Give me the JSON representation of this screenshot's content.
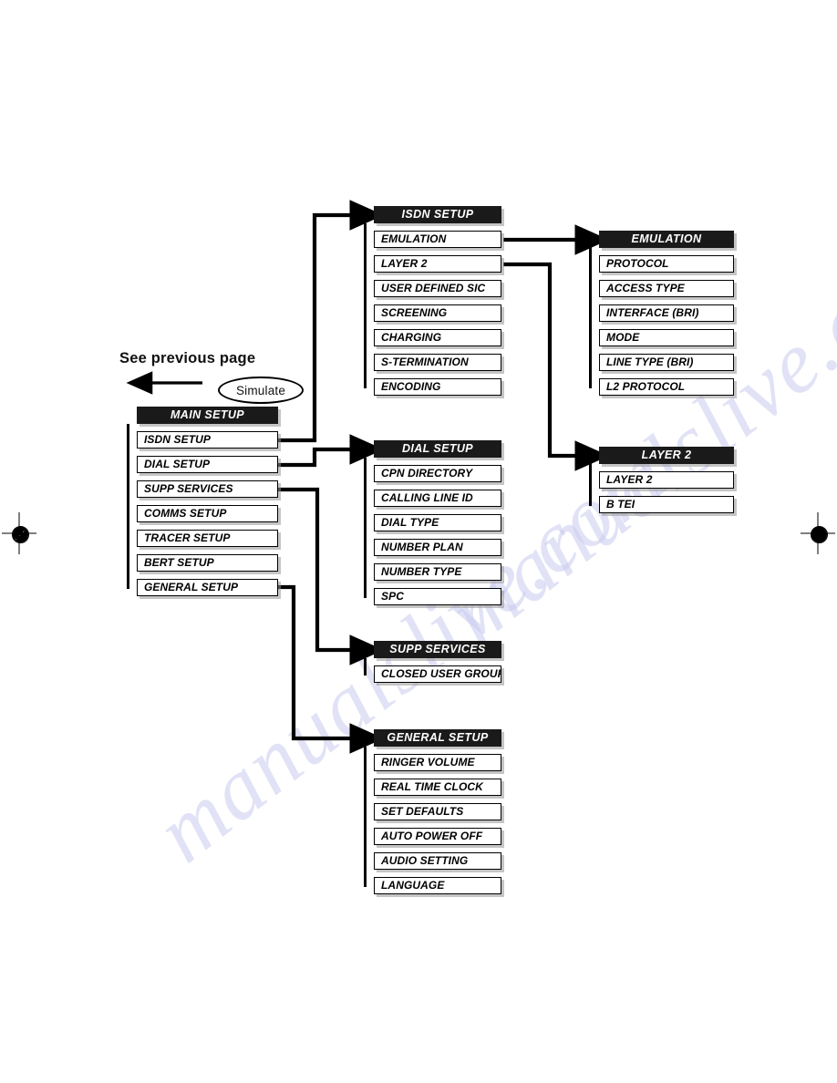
{
  "page": {
    "annotations": {
      "see_previous_page": "See previous page",
      "simulate": "Simulate"
    },
    "watermark": "manualslive.com",
    "colors": {
      "header_fill": "#1a1a1a",
      "header_text": "#ffffff",
      "item_fill": "#ffffff",
      "item_border": "#000000",
      "connector": "#000000",
      "shadow": "#969696",
      "watermark": "#c9ccef"
    }
  },
  "groups": {
    "main_setup": {
      "title": "MAIN SETUP",
      "items": [
        {
          "label": "ISDN SETUP"
        },
        {
          "label": "DIAL  SETUP"
        },
        {
          "label": "SUPP SERVICES"
        },
        {
          "label": "COMMS  SETUP"
        },
        {
          "label": "TRACER SETUP"
        },
        {
          "label": "BERT SETUP"
        },
        {
          "label": "GENERAL  SETUP"
        }
      ]
    },
    "isdn_setup": {
      "title": "ISDN SETUP",
      "items": [
        {
          "label": "EMULATION"
        },
        {
          "label": "LAYER 2"
        },
        {
          "label": "USER DEFINED SIC"
        },
        {
          "label": "SCREENING"
        },
        {
          "label": "CHARGING"
        },
        {
          "label": "S-TERMINATION"
        },
        {
          "label": "ENCODING"
        }
      ]
    },
    "emulation": {
      "title": "EMULATION",
      "items": [
        {
          "label": "PROTOCOL"
        },
        {
          "label": "ACCESS TYPE"
        },
        {
          "label": "INTERFACE (BRI)"
        },
        {
          "label": "MODE"
        },
        {
          "label": "LINE TYPE (BRI)"
        },
        {
          "label": "L2 PROTOCOL"
        }
      ]
    },
    "dial_setup": {
      "title": "DIAL SETUP",
      "items": [
        {
          "label": "CPN DIRECTORY"
        },
        {
          "label": "CALLING LINE ID"
        },
        {
          "label": "DIAL TYPE"
        },
        {
          "label": "NUMBER PLAN"
        },
        {
          "label": "NUMBER TYPE"
        },
        {
          "label": "SPC"
        }
      ]
    },
    "layer2": {
      "title": "LAYER 2",
      "items": [
        {
          "label": "LAYER 2"
        },
        {
          "label": "B TEI"
        }
      ]
    },
    "supp_services": {
      "title": "SUPP SERVICES",
      "items": [
        {
          "label": "CLOSED USER GROUP"
        }
      ]
    },
    "general_setup": {
      "title": "GENERAL SETUP",
      "items": [
        {
          "label": "RINGER VOLUME"
        },
        {
          "label": "REAL TIME CLOCK"
        },
        {
          "label": "SET DEFAULTS"
        },
        {
          "label": "AUTO POWER OFF"
        },
        {
          "label": "AUDIO SETTING"
        },
        {
          "label": "LANGUAGE"
        }
      ]
    }
  }
}
